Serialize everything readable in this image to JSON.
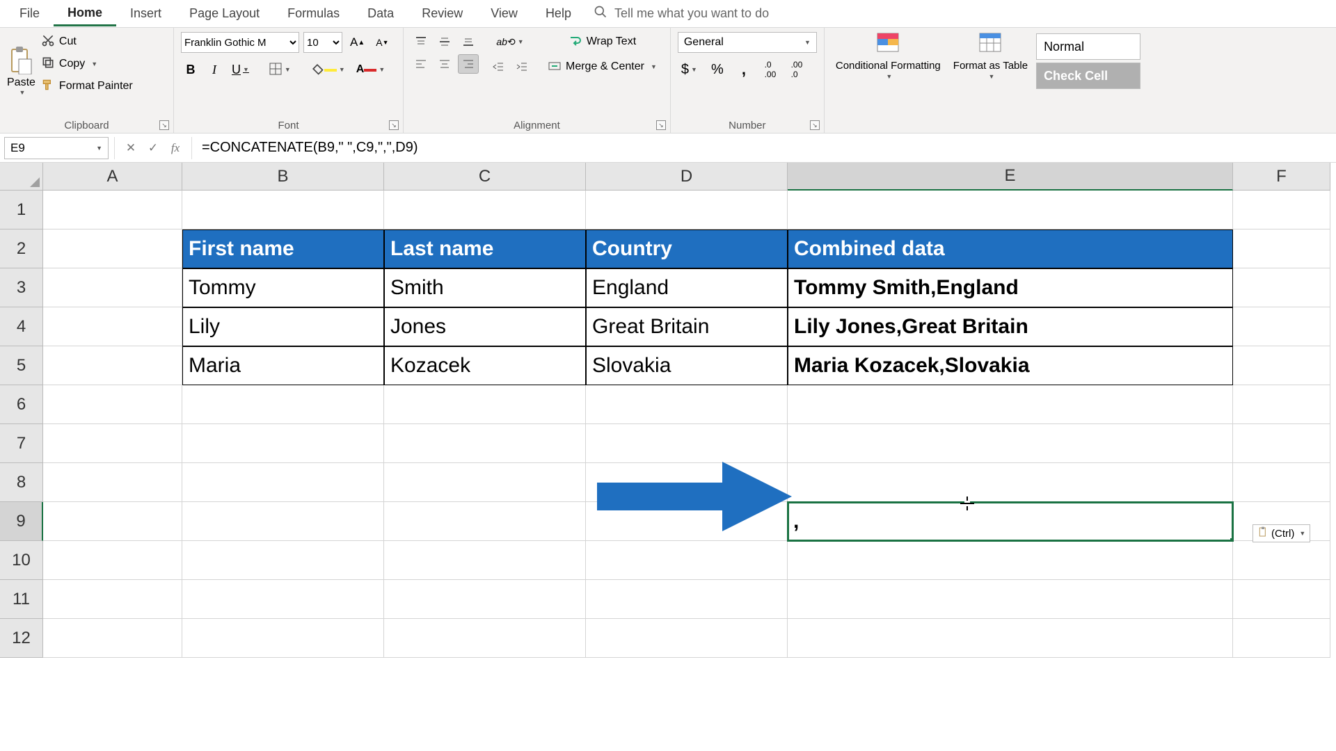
{
  "tabs": {
    "file": "File",
    "home": "Home",
    "insert": "Insert",
    "pagelayout": "Page Layout",
    "formulas": "Formulas",
    "data": "Data",
    "review": "Review",
    "view": "View",
    "help": "Help"
  },
  "tellme_placeholder": "Tell me what you want to do",
  "clipboard": {
    "paste": "Paste",
    "cut": "Cut",
    "copy": "Copy",
    "format_painter": "Format Painter",
    "group": "Clipboard"
  },
  "font": {
    "name": "Franklin Gothic M",
    "size": "10",
    "group": "Font"
  },
  "alignment": {
    "wrap": "Wrap Text",
    "merge": "Merge & Center",
    "group": "Alignment"
  },
  "number": {
    "format": "General",
    "group": "Number"
  },
  "cond": "Conditional Formatting",
  "fmt_table": "Format as Table",
  "styles": {
    "normal": "Normal",
    "check": "Check Cell"
  },
  "namebox": "E9",
  "formula": "=CONCATENATE(B9,\" \",C9,\",\",D9)",
  "columns": [
    "A",
    "B",
    "C",
    "D",
    "E",
    "F"
  ],
  "row_numbers": [
    "1",
    "2",
    "3",
    "4",
    "5",
    "6",
    "7",
    "8",
    "9",
    "10",
    "11",
    "12"
  ],
  "table": {
    "headers": {
      "first": "First name",
      "last": "Last name",
      "country": "Country",
      "combined": "Combined data"
    },
    "rows": [
      {
        "first": "Tommy",
        "last": "Smith",
        "country": "England",
        "combined": "Tommy Smith,England"
      },
      {
        "first": "Lily",
        "last": "Jones",
        "country": "Great Britain",
        "combined": "Lily  Jones,Great Britain"
      },
      {
        "first": "Maria",
        "last": "Kozacek",
        "country": "Slovakia",
        "combined": "Maria Kozacek,Slovakia"
      }
    ]
  },
  "e9_value": " ,",
  "paste_tag": "(Ctrl)"
}
